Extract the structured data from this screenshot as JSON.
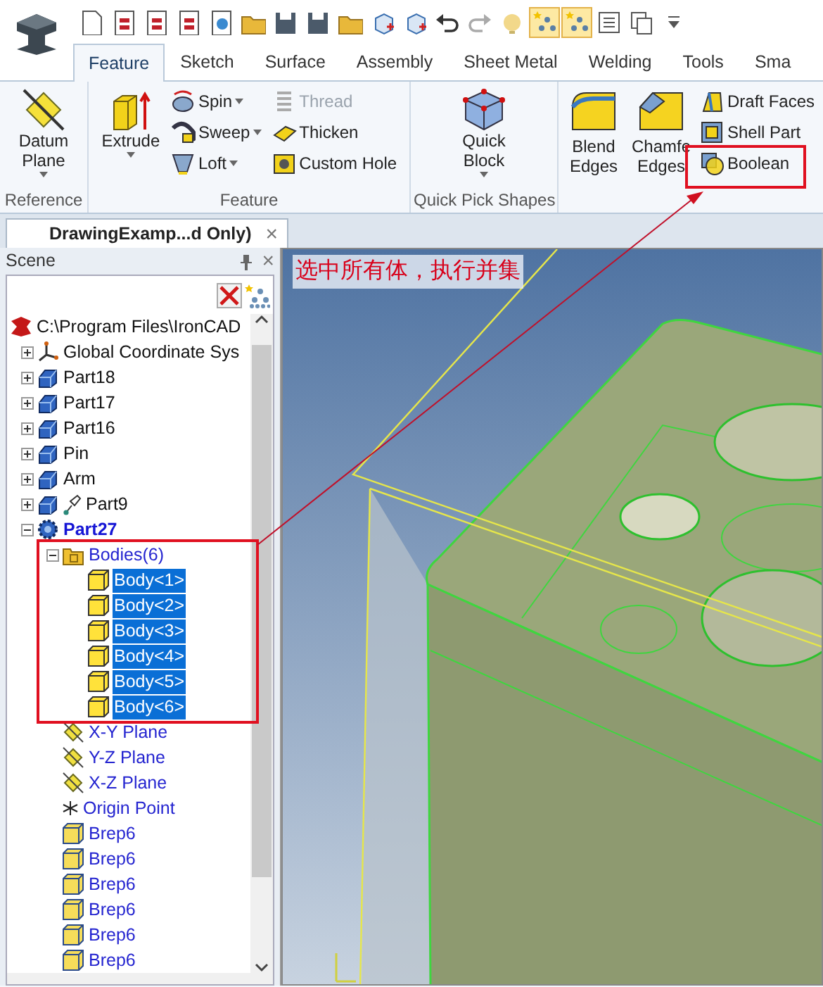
{
  "quick_access": [
    {
      "kind": "document",
      "on": false
    },
    {
      "kind": "red-document",
      "on": false
    },
    {
      "kind": "red-document",
      "on": false
    },
    {
      "kind": "red-document",
      "on": false
    },
    {
      "kind": "globe-document",
      "on": false
    },
    {
      "kind": "folder",
      "on": false
    },
    {
      "kind": "save",
      "on": false
    },
    {
      "kind": "save",
      "on": false
    },
    {
      "kind": "folder",
      "on": false
    },
    {
      "kind": "cube",
      "on": false
    },
    {
      "kind": "cube",
      "on": false
    },
    {
      "kind": "undo",
      "on": false
    },
    {
      "kind": "redo",
      "on": false
    },
    {
      "kind": "bulb",
      "on": false
    },
    {
      "kind": "tree",
      "on": true
    },
    {
      "kind": "tree",
      "on": true
    },
    {
      "kind": "list",
      "on": false
    },
    {
      "kind": "copy",
      "on": false
    },
    {
      "kind": "more",
      "on": false
    }
  ],
  "ribbon": {
    "tabs": [
      {
        "label": "Feature",
        "selected": true
      },
      {
        "label": "Sketch",
        "selected": false
      },
      {
        "label": "Surface",
        "selected": false
      },
      {
        "label": "Assembly",
        "selected": false
      },
      {
        "label": "Sheet Metal",
        "selected": false
      },
      {
        "label": "Welding",
        "selected": false
      },
      {
        "label": "Tools",
        "selected": false
      },
      {
        "label": "Sma",
        "selected": false
      }
    ],
    "groups": [
      {
        "label": "Reference",
        "columns": [
          {
            "kind": "large",
            "buttons": [
              {
                "label": "Datum Plane",
                "kind": "plane",
                "dropdown": true,
                "disabled": false
              }
            ]
          }
        ]
      },
      {
        "label": "Feature",
        "columns": [
          {
            "kind": "large",
            "buttons": [
              {
                "label": "Extrude",
                "kind": "extrude",
                "dropdown": true,
                "disabled": false
              }
            ]
          },
          {
            "kind": "small",
            "buttons": [
              {
                "label": "Spin",
                "kind": "spin",
                "dropdown": true,
                "disabled": false
              },
              {
                "label": "Sweep",
                "kind": "sweep",
                "dropdown": true,
                "disabled": false
              },
              {
                "label": "Loft",
                "kind": "loft",
                "dropdown": true,
                "disabled": false
              }
            ]
          },
          {
            "kind": "small",
            "buttons": [
              {
                "label": "Thread",
                "kind": "thread",
                "dropdown": false,
                "disabled": true
              },
              {
                "label": "Thicken",
                "kind": "thicken",
                "dropdown": false,
                "disabled": false
              },
              {
                "label": "Custom Hole",
                "kind": "hole",
                "dropdown": false,
                "disabled": false
              }
            ]
          }
        ]
      },
      {
        "label": "Quick Pick Shapes",
        "columns": [
          {
            "kind": "large",
            "buttons": [
              {
                "label": "Quick Block",
                "kind": "block",
                "dropdown": true,
                "disabled": false
              }
            ]
          }
        ]
      },
      {
        "columns": [
          {
            "kind": "large",
            "buttons": [
              {
                "label": "Blend Edges",
                "kind": "blend",
                "dropdown": false,
                "disabled": false
              }
            ]
          },
          {
            "kind": "large",
            "buttons": [
              {
                "label": "Chamfe Edges",
                "kind": "chamfer",
                "dropdown": false,
                "disabled": false
              }
            ]
          },
          {
            "kind": "small",
            "buttons": [
              {
                "label": "Draft Faces",
                "kind": "draft",
                "dropdown": false,
                "disabled": false
              },
              {
                "label": "Shell Part",
                "kind": "shell",
                "dropdown": false,
                "disabled": false
              },
              {
                "label": "Boolean",
                "kind": "boolean",
                "dropdown": false,
                "disabled": false
              }
            ]
          }
        ]
      }
    ]
  },
  "document_tab": {
    "title": "DrawingExamp...d Only)",
    "close": "×"
  },
  "scene": {
    "title": "Scene",
    "close": "×",
    "tree": [
      {
        "label": "C:\\Program Files\\IronCAD",
        "kind": "assembly",
        "selected": false,
        "children": [
          {
            "label": "Global Coordinate Sys",
            "kind": "axes",
            "expanded": false,
            "selected": false
          },
          {
            "label": "Part18",
            "kind": "part",
            "expanded": false,
            "selected": false
          },
          {
            "label": "Part17",
            "kind": "part",
            "expanded": false,
            "selected": false
          },
          {
            "label": "Part16",
            "kind": "part",
            "expanded": false,
            "selected": false
          },
          {
            "label": "Pin",
            "kind": "part",
            "expanded": false,
            "selected": false
          },
          {
            "label": "Arm",
            "kind": "part",
            "expanded": false,
            "selected": false
          },
          {
            "label": "Part9",
            "kind": "pinned-part",
            "expanded": false,
            "selected": false
          },
          {
            "label": "Part27",
            "kind": "gear",
            "expanded": true,
            "active": true,
            "selected": false,
            "children": [
              {
                "label": "Bodies(6)",
                "kind": "folder",
                "expanded": true,
                "selected": false,
                "children": [
                  {
                    "label": "Body<1>",
                    "kind": "body",
                    "selected": true
                  },
                  {
                    "label": "Body<2>",
                    "kind": "body",
                    "selected": true
                  },
                  {
                    "label": "Body<3>",
                    "kind": "body",
                    "selected": true
                  },
                  {
                    "label": "Body<4>",
                    "kind": "body",
                    "selected": true
                  },
                  {
                    "label": "Body<5>",
                    "kind": "body",
                    "selected": true
                  },
                  {
                    "label": "Body<6>",
                    "kind": "body",
                    "selected": true
                  }
                ]
              },
              {
                "label": "X-Y Plane",
                "kind": "plane",
                "selected": false
              },
              {
                "label": "Y-Z Plane",
                "kind": "plane",
                "selected": false
              },
              {
                "label": "X-Z Plane",
                "kind": "plane",
                "selected": false
              },
              {
                "label": "Origin Point",
                "kind": "point",
                "selected": false
              },
              {
                "label": "Brep6",
                "kind": "brep",
                "selected": false
              },
              {
                "label": "Brep6",
                "kind": "brep",
                "selected": false
              },
              {
                "label": "Brep6",
                "kind": "brep",
                "selected": false
              },
              {
                "label": "Brep6",
                "kind": "brep",
                "selected": false
              },
              {
                "label": "Brep6",
                "kind": "brep",
                "selected": false
              },
              {
                "label": "Brep6",
                "kind": "brep",
                "selected": false
              }
            ]
          }
        ]
      }
    ]
  },
  "viewport": {
    "note": "选中所有体，执行并集"
  }
}
